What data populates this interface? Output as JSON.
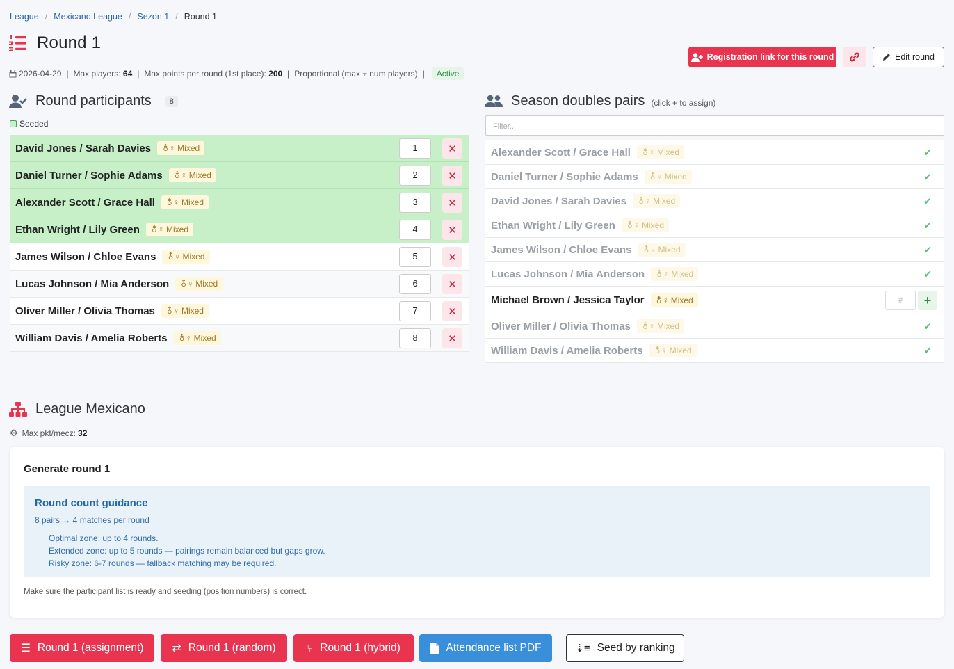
{
  "breadcrumb": {
    "l1": "League",
    "l2": "Mexicano League",
    "l3": "Sezon 1",
    "l4": "Round 1"
  },
  "page_title": "Round 1",
  "meta": {
    "date": "2026-04-29",
    "max_players_label": "Max players:",
    "max_players": "64",
    "max_points_label": "Max points per round (1st place):",
    "max_points": "200",
    "proportional": "Proportional (max ÷ num players)",
    "status": "Active"
  },
  "buttons": {
    "registration": "Registration link for this round",
    "edit": "Edit round"
  },
  "participants": {
    "title": "Round participants",
    "count": "8",
    "seeded_label": "Seeded",
    "rows": [
      {
        "name": "David Jones / Sarah Davies",
        "tag": "Mixed",
        "seed": "1"
      },
      {
        "name": "Daniel Turner / Sophie Adams",
        "tag": "Mixed",
        "seed": "2"
      },
      {
        "name": "Alexander Scott / Grace Hall",
        "tag": "Mixed",
        "seed": "3"
      },
      {
        "name": "Ethan Wright / Lily Green",
        "tag": "Mixed",
        "seed": "4"
      },
      {
        "name": "James Wilson / Chloe Evans",
        "tag": "Mixed",
        "seed": "5"
      },
      {
        "name": "Lucas Johnson / Mia Anderson",
        "tag": "Mixed",
        "seed": "6"
      },
      {
        "name": "Oliver Miller / Olivia Thomas",
        "tag": "Mixed",
        "seed": "7"
      },
      {
        "name": "William Davis / Amelia Roberts",
        "tag": "Mixed",
        "seed": "8"
      }
    ]
  },
  "pairs": {
    "title": "Season doubles pairs",
    "hint": "(click + to assign)",
    "filter_placeholder": "Filter...",
    "hash_placeholder": "#",
    "rows": [
      {
        "name": "Alexander Scott / Grace Hall",
        "tag": "Mixed"
      },
      {
        "name": "Daniel Turner / Sophie Adams",
        "tag": "Mixed"
      },
      {
        "name": "David Jones / Sarah Davies",
        "tag": "Mixed"
      },
      {
        "name": "Ethan Wright / Lily Green",
        "tag": "Mixed"
      },
      {
        "name": "James Wilson / Chloe Evans",
        "tag": "Mixed"
      },
      {
        "name": "Lucas Johnson / Mia Anderson",
        "tag": "Mixed"
      },
      {
        "name": "Michael Brown / Jessica Taylor",
        "tag": "Mixed"
      },
      {
        "name": "Oliver Miller / Olivia Thomas",
        "tag": "Mixed"
      },
      {
        "name": "William Davis / Amelia Roberts",
        "tag": "Mixed"
      }
    ]
  },
  "mexicano": {
    "title": "League Mexicano",
    "max_label": "Max pkt/mecz:",
    "max_value": "32",
    "generate_title": "Generate round 1",
    "guidance_title": "Round count guidance",
    "guidance_sub": "8 pairs → 4 matches per round",
    "zone1": "Optimal zone: up to 4 rounds.",
    "zone2": "Extended zone: up to 5 rounds — pairings remain balanced but gaps grow.",
    "zone3": "Risky zone: 6-7 rounds — fallback matching may be required.",
    "note": "Make sure the participant list is ready and seeding (position numbers) is correct."
  },
  "bottom": {
    "assignment": "Round 1 (assignment)",
    "random": "Round 1 (random)",
    "hybrid": "Round 1 (hybrid)",
    "pdf": "Attendance list PDF",
    "seed": "Seed by ranking"
  },
  "colors": {
    "accent": "#e8344f",
    "seeded_bg": "#c7f0c9",
    "blue": "#3a8fdb",
    "link": "#2c67a9"
  }
}
